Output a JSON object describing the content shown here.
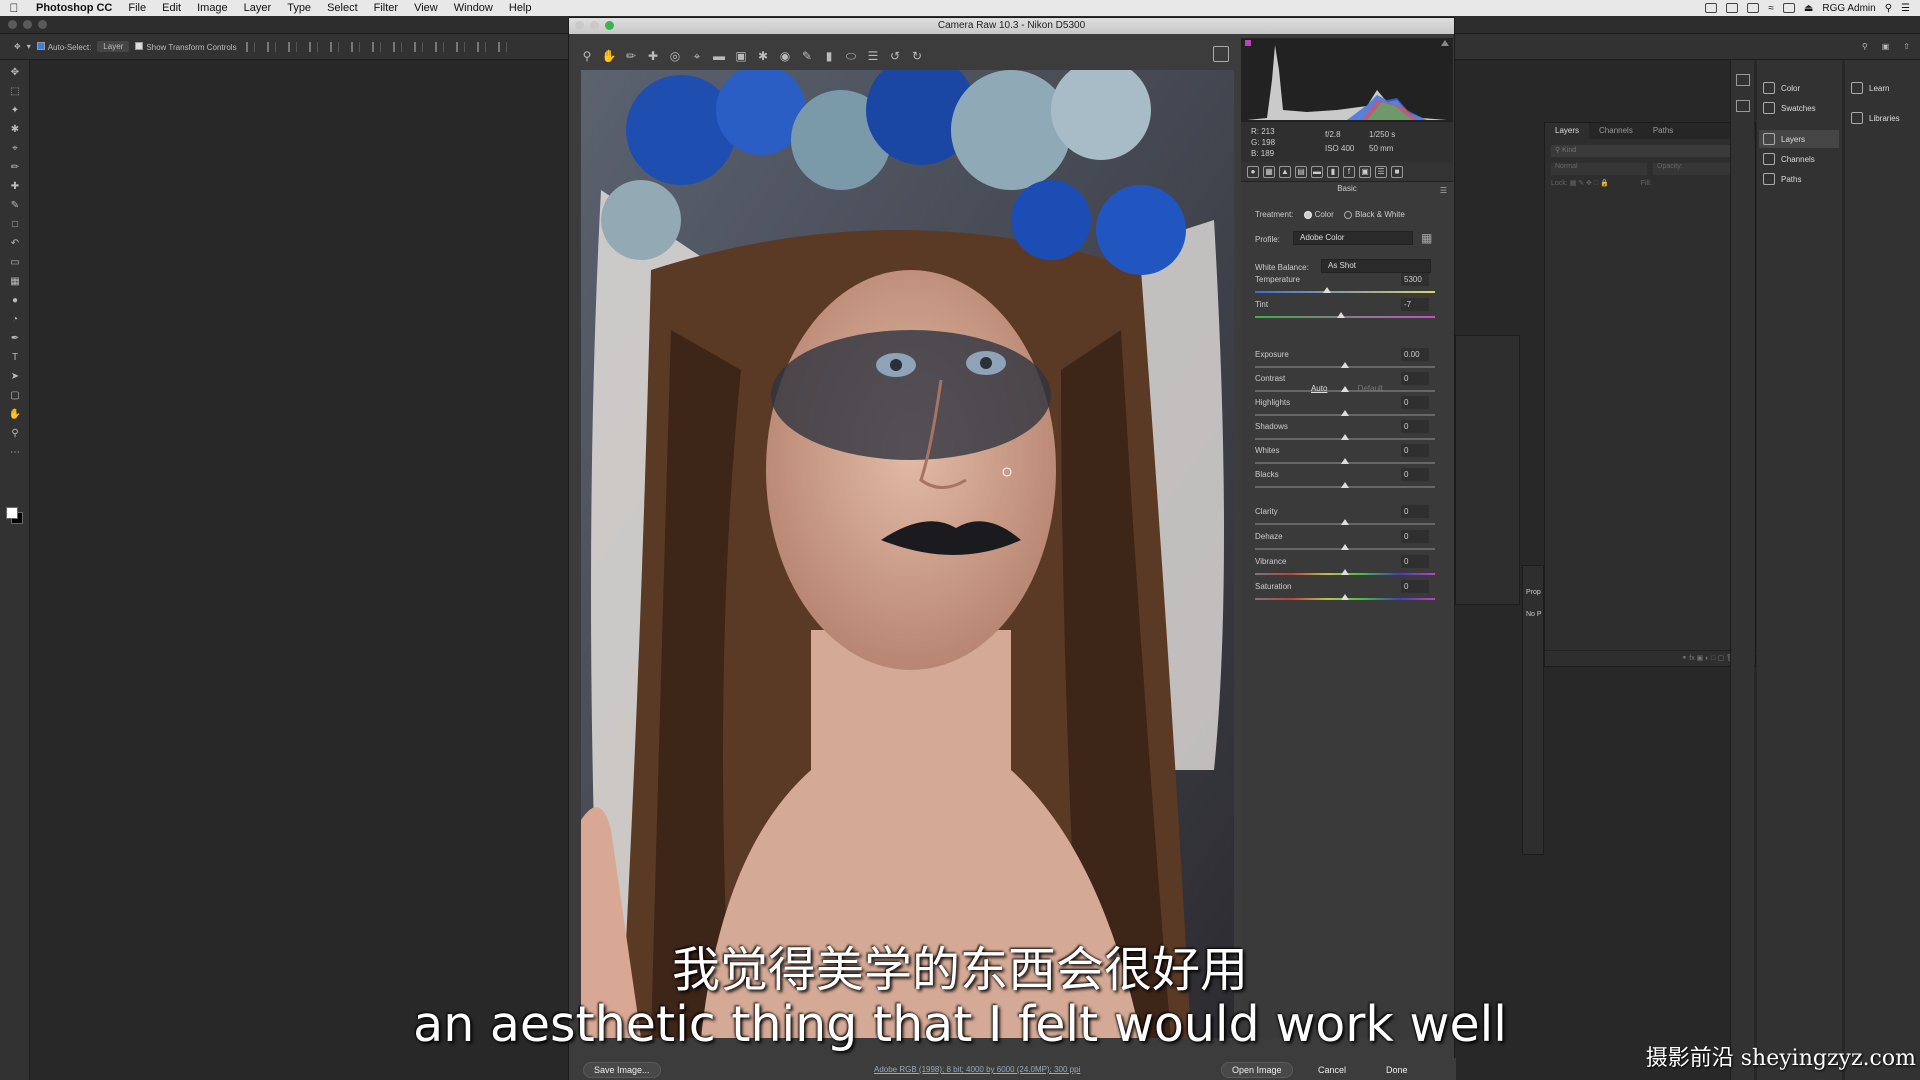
{
  "menubar": {
    "app": "Photoshop CC",
    "items": [
      "File",
      "Edit",
      "Image",
      "Layer",
      "Type",
      "Select",
      "Filter",
      "View",
      "Window",
      "Help"
    ],
    "user": "RGG Admin"
  },
  "options": {
    "auto_select_label": "Auto-Select:",
    "auto_select_value": "Layer",
    "transform_label": "Show Transform Controls"
  },
  "camera_raw": {
    "title": "Camera Raw 10.3  -  Nikon D5300",
    "readout": {
      "r": "R:  213",
      "g": "G:  198",
      "b": "B:  189",
      "aperture": "f/2.8",
      "shutter": "1/250 s",
      "iso": "ISO 400",
      "focal": "50 mm"
    },
    "panel_title": "Basic",
    "treatment_label": "Treatment:",
    "treatment_color": "Color",
    "treatment_bw": "Black & White",
    "profile_label": "Profile:",
    "profile_value": "Adobe Color",
    "wb_label": "White Balance:",
    "wb_value": "As Shot",
    "auto": "Auto",
    "default": "Default",
    "sliders": [
      {
        "label": "Temperature",
        "value": "5300",
        "pos": 0.4
      },
      {
        "label": "Tint",
        "value": "-7",
        "pos": 0.48
      },
      {
        "label": "Exposure",
        "value": "0.00",
        "pos": 0.5
      },
      {
        "label": "Contrast",
        "value": "0",
        "pos": 0.5
      },
      {
        "label": "Highlights",
        "value": "0",
        "pos": 0.5
      },
      {
        "label": "Shadows",
        "value": "0",
        "pos": 0.5
      },
      {
        "label": "Whites",
        "value": "0",
        "pos": 0.5
      },
      {
        "label": "Blacks",
        "value": "0",
        "pos": 0.5
      },
      {
        "label": "Clarity",
        "value": "0",
        "pos": 0.5
      },
      {
        "label": "Dehaze",
        "value": "0",
        "pos": 0.5
      },
      {
        "label": "Vibrance",
        "value": "0",
        "pos": 0.5
      },
      {
        "label": "Saturation",
        "value": "0",
        "pos": 0.5
      }
    ],
    "save_button": "Save Image...",
    "workflow_text": "Adobe RGB (1998); 8 bit; 4000 by 6000 (24.0MP); 300 ppi",
    "open_button": "Open Image",
    "cancel_button": "Cancel",
    "done_button": "Done"
  },
  "dock": {
    "color": "Color",
    "swatches": "Swatches",
    "layers": "Layers",
    "channels": "Channels",
    "paths": "Paths",
    "learn": "Learn",
    "libraries": "Libraries"
  },
  "layers_panel": {
    "tabs": [
      "Layers",
      "Channels",
      "Paths"
    ],
    "filter": "Kind",
    "blend": "Normal",
    "opacity": "Opacity:",
    "lock": "Lock:",
    "fill": "Fill:"
  },
  "properties": {
    "title": "Prop",
    "body": "No P"
  },
  "subtitles": {
    "chinese": "我觉得美学的东西会很好用",
    "english": "an aesthetic thing that I felt would work well"
  },
  "watermark": "摄影前沿 sheyingzyz.com"
}
